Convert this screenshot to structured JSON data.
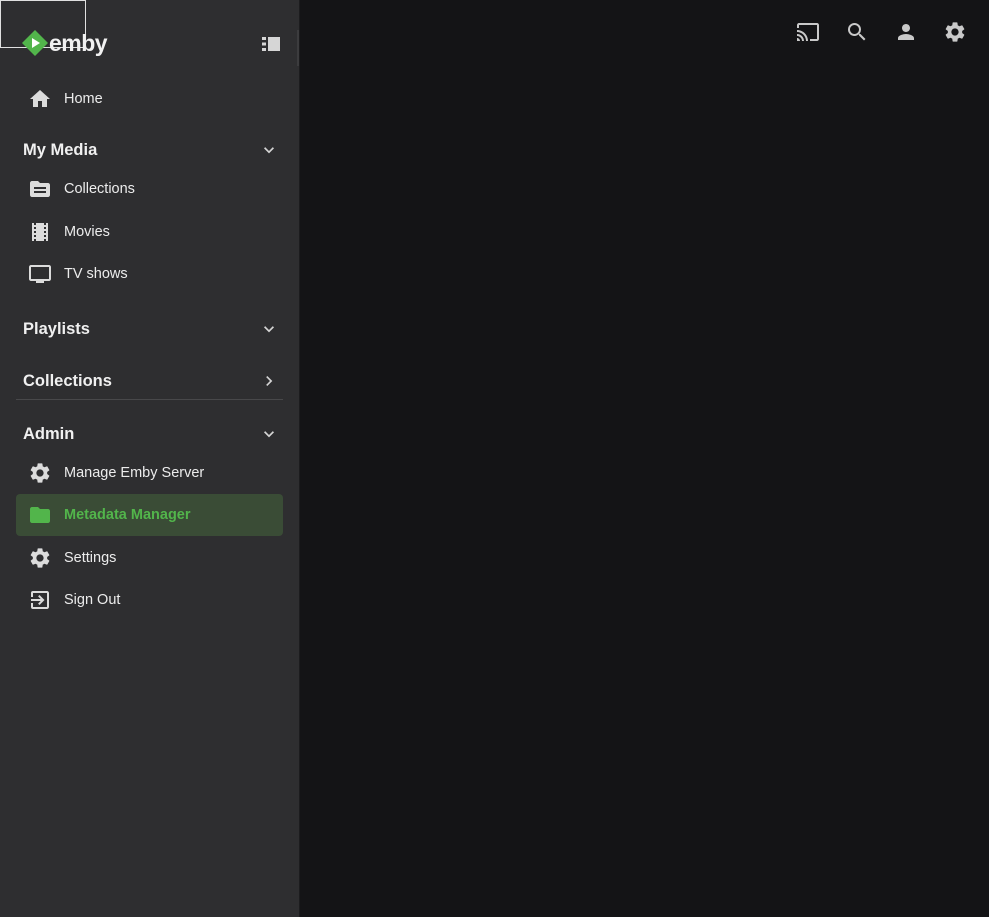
{
  "logo": {
    "text": "emby",
    "brand_color": "#52b54b"
  },
  "header": {
    "icons": [
      "cast-icon",
      "search-icon",
      "user-icon",
      "settings-icon"
    ]
  },
  "sidebar": {
    "home": {
      "label": "Home",
      "icon": "home-icon"
    },
    "my_media": {
      "title": "My Media",
      "items": [
        {
          "label": "Collections",
          "icon": "folder-collections-icon"
        },
        {
          "label": "Movies",
          "icon": "film-icon"
        },
        {
          "label": "TV shows",
          "icon": "tv-icon"
        }
      ]
    },
    "playlists": {
      "title": "Playlists"
    },
    "collections": {
      "title": "Collections"
    },
    "admin": {
      "title": "Admin",
      "items": [
        {
          "label": "Manage Emby Server",
          "icon": "gear-icon"
        },
        {
          "label": "Metadata Manager",
          "icon": "folder-icon",
          "active": true
        },
        {
          "label": "Settings",
          "icon": "gear-icon"
        },
        {
          "label": "Sign Out",
          "icon": "sign-out-icon"
        }
      ]
    }
  },
  "colors": {
    "background": "#141416",
    "sidebar": "#2e2e30",
    "active_bg": "#3a4c36",
    "accent": "#52b54b"
  }
}
